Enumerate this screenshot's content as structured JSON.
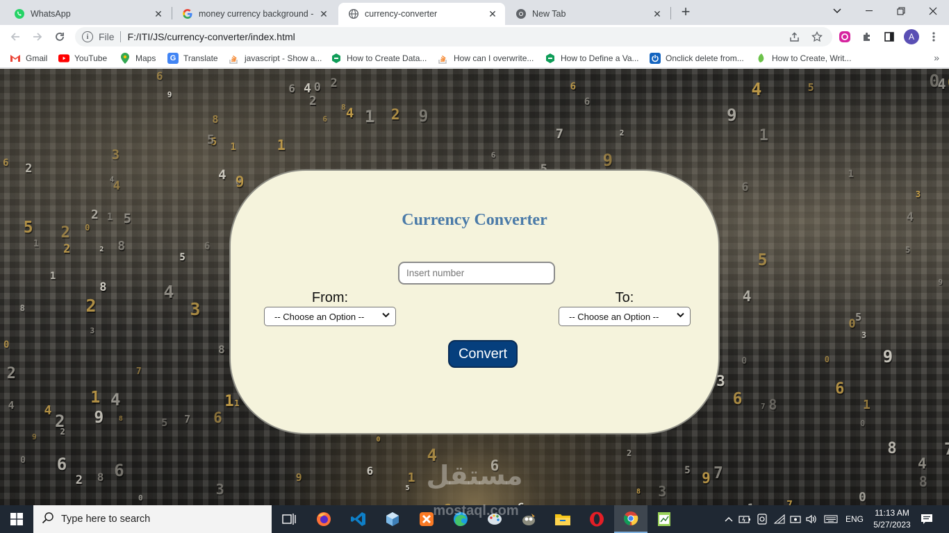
{
  "browser": {
    "tabs": [
      {
        "title": "WhatsApp",
        "icon": "whatsapp-icon",
        "active": false
      },
      {
        "title": "money currency background - Go",
        "icon": "google-icon",
        "active": false
      },
      {
        "title": "currency-converter",
        "icon": "globe-icon",
        "active": true
      },
      {
        "title": "New Tab",
        "icon": "chrome-icon",
        "active": false
      }
    ],
    "address": {
      "scheme": "File",
      "url": "F:/ITI/JS/currency-converter/index.html"
    },
    "profile_initial": "A",
    "bookmarks": [
      {
        "label": "Gmail",
        "icon": "gmail-icon"
      },
      {
        "label": "YouTube",
        "icon": "youtube-icon"
      },
      {
        "label": "Maps",
        "icon": "maps-icon"
      },
      {
        "label": "Translate",
        "icon": "translate-icon"
      },
      {
        "label": "javascript - Show a...",
        "icon": "stackoverflow-icon"
      },
      {
        "label": "How to Create Data...",
        "icon": "geeks-icon"
      },
      {
        "label": "How can I overwrite...",
        "icon": "stackoverflow-icon"
      },
      {
        "label": "How to Define a Va...",
        "icon": "geeks-icon"
      },
      {
        "label": "Onclick delete from...",
        "icon": "power-icon"
      },
      {
        "label": "How to Create, Writ...",
        "icon": "leaf-icon"
      }
    ]
  },
  "page": {
    "title": "Currency Converter",
    "amount_placeholder": "Insert number",
    "from_label": "From:",
    "to_label": "To:",
    "from_selected": "-- Choose an Option --",
    "to_selected": "-- Choose an Option --",
    "convert_label": "Convert",
    "colors": {
      "card": "#f5f3dc",
      "title": "#4a7aa8",
      "button": "#063f7d"
    }
  },
  "watermark": {
    "arabic": "مستقل",
    "latin": "mostaql.com"
  },
  "taskbar": {
    "search_placeholder": "Type here to search",
    "apps": [
      "task-view-icon",
      "firefox-icon",
      "vscode-icon",
      "virtualbox-icon",
      "xampp-icon",
      "edge-icon",
      "paint-icon",
      "gimp-icon",
      "file-explorer-icon",
      "opera-icon",
      "chrome-icon",
      "notepad-icon"
    ],
    "language": "ENG",
    "time": "11:13 AM",
    "date": "5/27/2023"
  }
}
